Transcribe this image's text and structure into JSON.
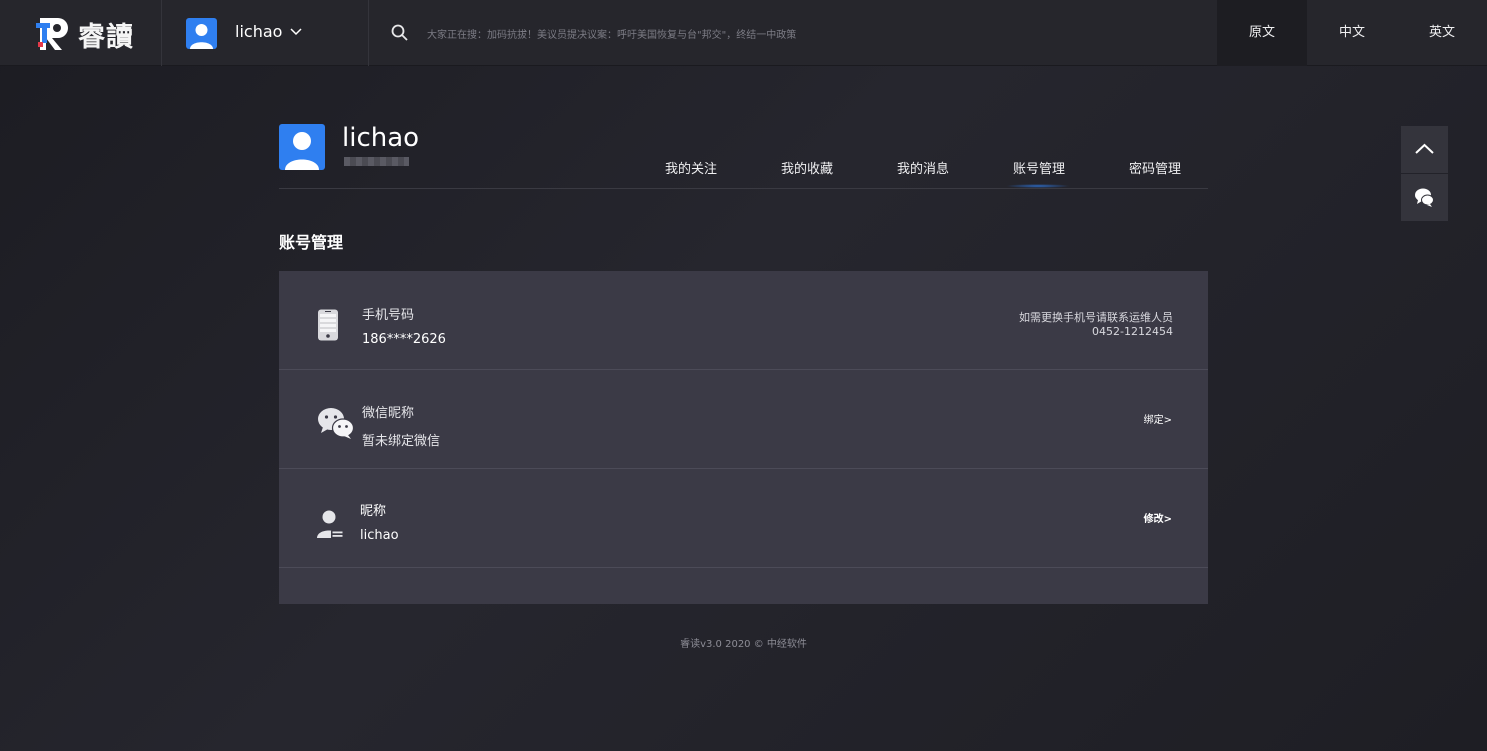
{
  "brand": {
    "name": "睿讀",
    "accent": "#2f7ff0",
    "mark_colors": [
      "#2f7ff0",
      "#e53a4a"
    ]
  },
  "header": {
    "username": "lichao",
    "search_hint": "大家正在搜：加码抗拔！美议员提决议案：呼吁美国恢复与台\"邦交\"，终结一中政策",
    "languages": [
      {
        "label": "原文",
        "active": true
      },
      {
        "label": "中文",
        "active": false
      },
      {
        "label": "英文",
        "active": false
      }
    ]
  },
  "profile": {
    "name": "lichao",
    "tabs": [
      {
        "label": "我的关注",
        "active": false
      },
      {
        "label": "我的收藏",
        "active": false
      },
      {
        "label": "我的消息",
        "active": false
      },
      {
        "label": "账号管理",
        "active": true
      },
      {
        "label": "密码管理",
        "active": false
      }
    ]
  },
  "account": {
    "title": "账号管理",
    "phone": {
      "icon": "phone-icon",
      "label": "手机号码",
      "value": "186****2626",
      "note_line1": "如需更换手机号请联系运维人员",
      "note_line2": "0452-1212454"
    },
    "wechat": {
      "icon": "wechat-icon",
      "label": "微信昵称",
      "value": "暂未绑定微信",
      "action": "绑定>"
    },
    "nickname": {
      "icon": "user-card-icon",
      "label": "昵称",
      "value": "lichao",
      "action": "修改>"
    }
  },
  "footer": {
    "text": "睿读v3.0 2020 © 中经软件"
  },
  "side": {
    "up_icon": "chevron-up-icon",
    "chat_icon": "chat-bubble-icon"
  }
}
